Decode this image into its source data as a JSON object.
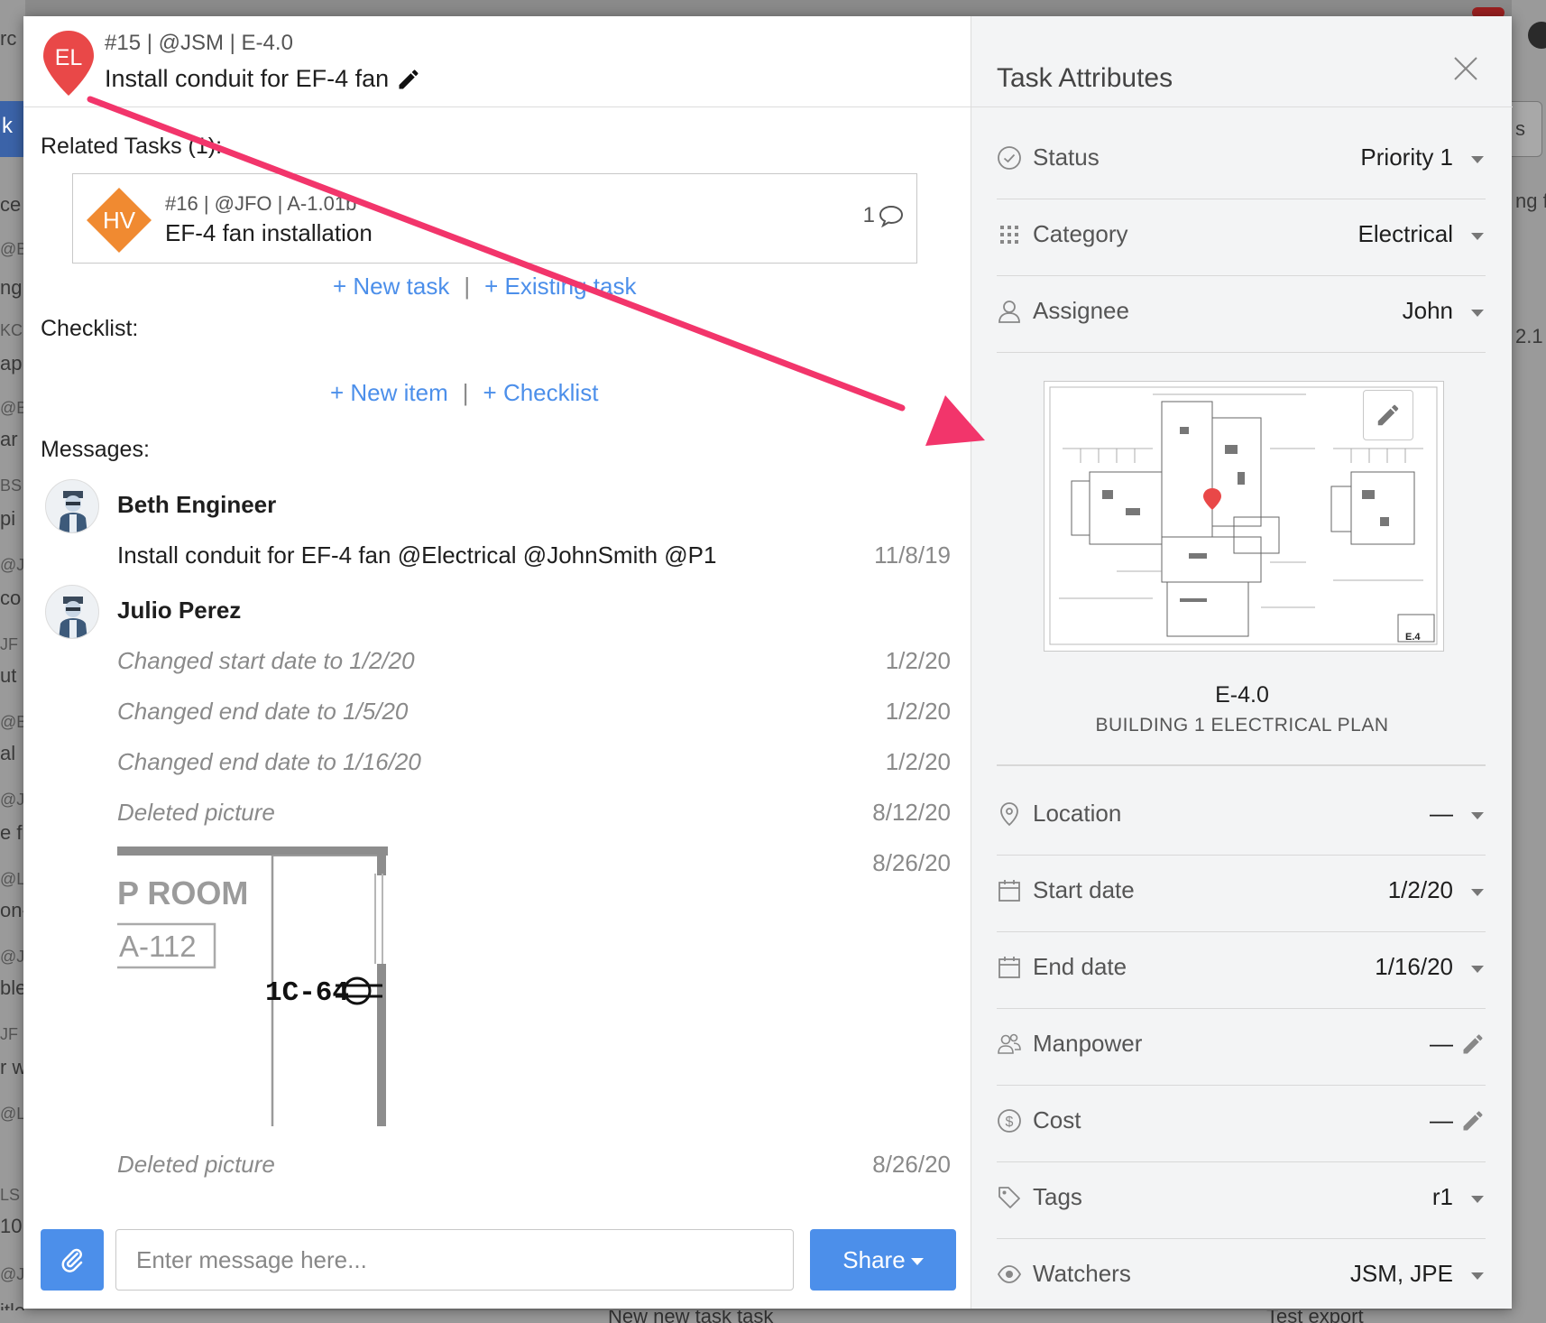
{
  "background": {
    "left_fragments": [
      "rc",
      "k",
      "ce",
      "@B",
      "ng",
      "KC",
      "ap",
      "@B",
      "ar",
      "BS",
      "pi",
      "@J",
      "co",
      "JF",
      "ut",
      "@B",
      "al",
      "@J",
      "e f",
      "@L",
      "on-",
      "@J",
      "ble",
      "JF",
      "r w",
      "@L",
      "LS",
      "10",
      "@J",
      "itle"
    ],
    "right_fragments": [
      "s",
      "ng f",
      "2.1"
    ],
    "bottom_fragments": [
      "New new task task",
      "Test export"
    ]
  },
  "task": {
    "avatar_initials": "EL",
    "avatar_color": "#e94848",
    "meta": "#15 | @JSM | E-4.0",
    "title": "Install conduit for EF-4 fan"
  },
  "related": {
    "label": "Related Tasks (1):",
    "items": [
      {
        "initials": "HV",
        "color": "#f08a31",
        "meta": "#16 | @JFO | A-1.01b",
        "title": "EF-4 fan installation",
        "comment_count": "1"
      }
    ],
    "new_task": "+ New task",
    "existing_task": "+ Existing task",
    "separator": "|"
  },
  "checklist": {
    "label": "Checklist:",
    "new_item": "+ New item",
    "add_checklist": "+ Checklist",
    "separator": "|"
  },
  "messages": {
    "label": "Messages:",
    "threads": [
      {
        "author": "Beth Engineer",
        "entries": [
          {
            "text": "Install conduit for EF-4 fan @Electrical @JohnSmith  @P1",
            "date": "11/8/19"
          }
        ]
      },
      {
        "author": "Julio Perez",
        "entries": [
          {
            "text": "Changed start date to 1/2/20",
            "date": "1/2/20"
          },
          {
            "text": "Changed end date to 1/5/20",
            "date": "1/2/20"
          },
          {
            "text": "Changed end date to 1/16/20",
            "date": "1/2/20"
          },
          {
            "text": "Deleted picture",
            "date": "8/12/20"
          },
          {
            "text": "",
            "date": "8/26/20"
          },
          {
            "text": "Deleted picture",
            "date": "8/26/20"
          }
        ]
      }
    ],
    "picture": {
      "room_label": "P ROOM",
      "room_number": "A-112",
      "device_tag": "1C-64"
    }
  },
  "composer": {
    "placeholder": "Enter message here...",
    "share_label": "Share"
  },
  "attributes": {
    "title": "Task Attributes",
    "rows_top": [
      {
        "label": "Status",
        "value": "Priority 1",
        "icon": "check-circle-icon"
      },
      {
        "label": "Category",
        "value": "Electrical",
        "icon": "grid-dots-icon"
      },
      {
        "label": "Assignee",
        "value": "John",
        "icon": "user-icon"
      }
    ],
    "sheet": {
      "number": "E-4.0",
      "name": "BUILDING 1 ELECTRICAL PLAN",
      "stamp": "E.4"
    },
    "rows_bottom": [
      {
        "label": "Location",
        "value": "—",
        "icon": "location-pin-icon",
        "control": "caret"
      },
      {
        "label": "Start date",
        "value": "1/2/20",
        "icon": "calendar-icon",
        "control": "caret"
      },
      {
        "label": "End date",
        "value": "1/16/20",
        "icon": "calendar-icon",
        "control": "caret"
      },
      {
        "label": "Manpower",
        "value": "—",
        "icon": "people-icon",
        "control": "pencil"
      },
      {
        "label": "Cost",
        "value": "—",
        "icon": "dollar-circle-icon",
        "control": "pencil"
      },
      {
        "label": "Tags",
        "value": "r1",
        "icon": "tag-icon",
        "control": "caret"
      },
      {
        "label": "Watchers",
        "value": "JSM, JPE",
        "icon": "eye-icon",
        "control": "caret"
      }
    ]
  },
  "colors": {
    "accent": "#4c8fea",
    "annotation_arrow": "#f2356b"
  }
}
